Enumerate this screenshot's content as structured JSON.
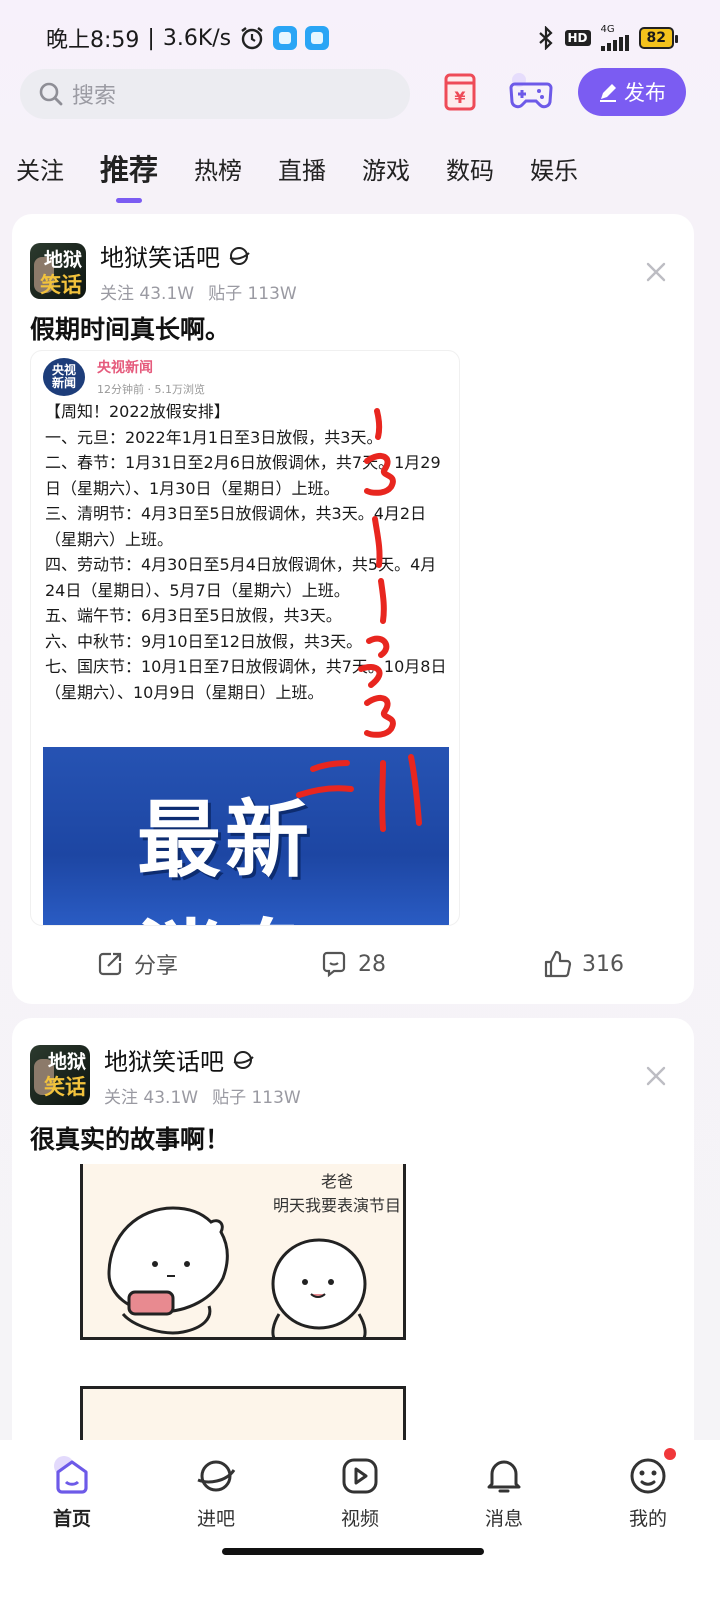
{
  "status_bar": {
    "time": "晚上8:59",
    "speed": "3.6K/s",
    "hd": "HD",
    "network": "4G",
    "battery": "82"
  },
  "header": {
    "search_placeholder": "搜索",
    "publish_label": "发布",
    "icons": [
      "search-icon",
      "red-packet-icon",
      "gamepad-icon",
      "pencil-icon"
    ]
  },
  "tabs": [
    {
      "label": "关注"
    },
    {
      "label": "推荐",
      "active": true
    },
    {
      "label": "热榜"
    },
    {
      "label": "直播"
    },
    {
      "label": "游戏"
    },
    {
      "label": "数码"
    },
    {
      "label": "娱乐"
    }
  ],
  "posts": [
    {
      "forum": "地狱笑话吧",
      "avatar_text_top": "地狱",
      "avatar_text_bottom": "笑话",
      "followers": "关注 43.1W",
      "posts": "贴子 113W",
      "title": "假期时间真长啊。",
      "image": {
        "source_name": "央视新闻",
        "logo_top": "央视",
        "logo_bottom": "新闻",
        "source_sub": "12分钟前 · 5.1万浏览",
        "lines": [
          "【周知！2022放假安排】",
          "一、元旦：2022年1月1日至3日放假，共3天。",
          "二、春节：1月31日至2月6日放假调休，共7天。1月29日（星期六）、1月30日（星期日）上班。",
          "三、清明节：4月3日至5日放假调休，共3天。4月2日（星期六）上班。",
          "四、劳动节：4月30日至5月4日放假调休，共5天。4月24日（星期日）、5月7日（星期六）上班。",
          "五、端午节：6月3日至5日放假，共3天。",
          "六、中秋节：9月10日至12日放假，共3天。",
          "七、国庆节：10月1日至7日放假调休，共7天。10月8日（星期六）、10月9日（星期日）上班。"
        ],
        "banner_line1": "最新",
        "banner_line2": "消息"
      },
      "share_label": "分享",
      "comments": "28",
      "likes": "316"
    },
    {
      "forum": "地狱笑话吧",
      "avatar_text_top": "地狱",
      "avatar_text_bottom": "笑话",
      "followers": "关注 43.1W",
      "posts": "贴子 113W",
      "title": "很真实的故事啊！",
      "comic_speech_1": "老爸",
      "comic_speech_2": "明天我要表演节目"
    }
  ],
  "bottom_nav": [
    {
      "label": "首页",
      "icon": "home-icon",
      "active": true
    },
    {
      "label": "进吧",
      "icon": "planet-icon"
    },
    {
      "label": "视频",
      "icon": "video-icon"
    },
    {
      "label": "消息",
      "icon": "bell-icon"
    },
    {
      "label": "我的",
      "icon": "smiley-icon",
      "badge": true
    }
  ],
  "colors": {
    "accent": "#7b5cf2",
    "badge_red": "#f0373a",
    "news_pink": "#e55a7c",
    "banner_blue": "#2653b3",
    "scribble_red": "#e8261f"
  }
}
